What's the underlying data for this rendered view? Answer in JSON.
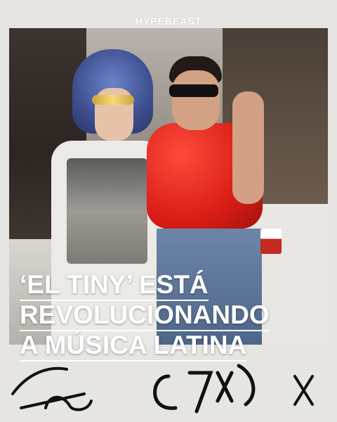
{
  "brand": "HYPEBEAST",
  "headline": {
    "line1": "‘EL TINY’ ESTÁ",
    "line2": "REVOLUCIONANDO",
    "line3": "A MÚSICA LATINA"
  },
  "colors": {
    "frame": "#e7e5e1",
    "text": "#ffffff",
    "vest": "#d81e16",
    "hat": "#3d4f8f"
  }
}
